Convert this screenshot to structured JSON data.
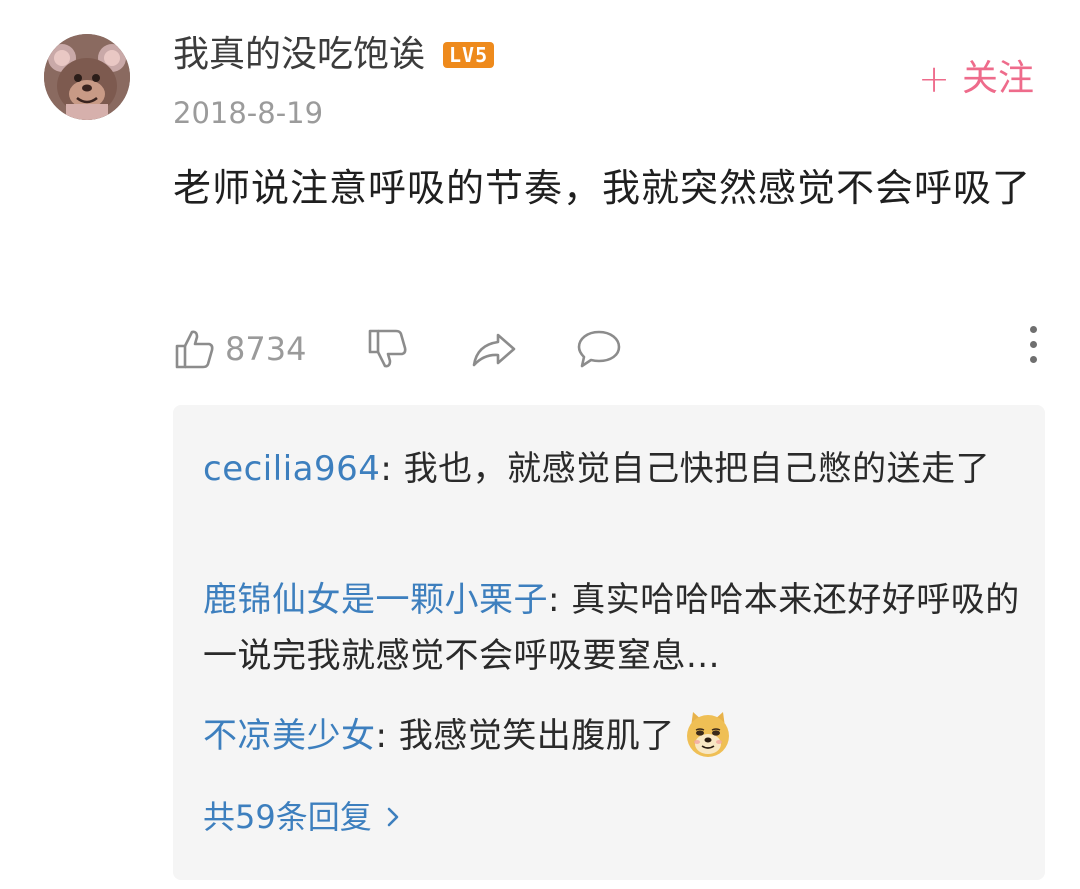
{
  "comment": {
    "user": {
      "name": "我真的没吃饱诶",
      "level": "LV5"
    },
    "date": "2018-8-19",
    "follow_label": "关注",
    "follow_icon": "plus-icon",
    "text": "老师说注意呼吸的节奏，我就突然感觉不会呼吸了",
    "like_count": "8734",
    "icons": {
      "like": "thumb-up-icon",
      "dislike": "thumb-down-icon",
      "share": "share-icon",
      "comment": "comment-icon",
      "more": "more-vertical-icon"
    }
  },
  "replies": [
    {
      "author": "cecilia964",
      "separator": ": ",
      "text": "我也，就感觉自己快把自己憋的送走了"
    },
    {
      "author": "鹿锦仙女是一颗小栗子",
      "separator": ": ",
      "text": "真实哈哈哈本来还好好呼吸的一说完我就感觉不会呼吸要窒息..."
    },
    {
      "author": "不凉美少女",
      "separator": ": ",
      "text": "我感觉笑出腹肌了",
      "emoji": "doge-emoji"
    }
  ],
  "view_all": {
    "label": "共59条回复",
    "icon": "chevron-right-icon"
  },
  "colors": {
    "accent_pink": "#ee6b8b",
    "link_blue": "#3d7fbe",
    "level_orange": "#ee8a1c",
    "reply_bg": "#f5f5f5"
  }
}
